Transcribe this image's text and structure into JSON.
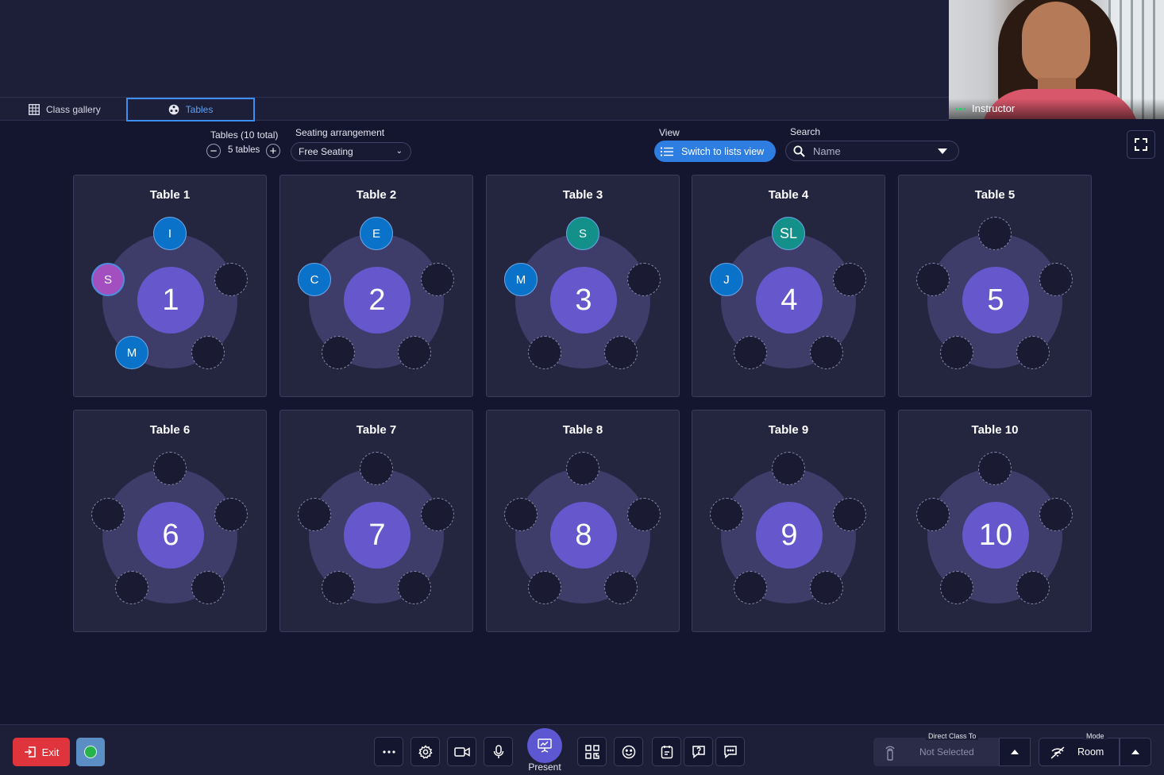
{
  "tabs": {
    "gallery_label": "Class gallery",
    "tables_label": "Tables"
  },
  "instructor": {
    "label": "Instructor"
  },
  "controls": {
    "tables_total_label": "Tables (10 total)",
    "tables_count": "5 tables",
    "seating_label": "Seating arrangement",
    "seating_value": "Free Seating",
    "view_label": "View",
    "switch_view_label": "Switch to lists view",
    "search_label": "Search",
    "search_value": "Name"
  },
  "tables": [
    {
      "name": "Table 1",
      "number": "1",
      "seats": [
        {
          "initial": "I",
          "color": "#0a72c9"
        },
        {
          "initial": "",
          "color": ""
        },
        {
          "initial": "",
          "color": ""
        },
        {
          "initial": "M",
          "color": "#0a72c9"
        },
        {
          "initial": "S",
          "color": "#a34fbf"
        }
      ]
    },
    {
      "name": "Table 2",
      "number": "2",
      "seats": [
        {
          "initial": "E",
          "color": "#0a72c9"
        },
        {
          "initial": "",
          "color": ""
        },
        {
          "initial": "",
          "color": ""
        },
        {
          "initial": "",
          "color": ""
        },
        {
          "initial": "C",
          "color": "#0a72c9"
        }
      ]
    },
    {
      "name": "Table 3",
      "number": "3",
      "seats": [
        {
          "initial": "S",
          "color": "#13908a"
        },
        {
          "initial": "",
          "color": ""
        },
        {
          "initial": "",
          "color": ""
        },
        {
          "initial": "",
          "color": ""
        },
        {
          "initial": "M",
          "color": "#0a72c9"
        }
      ]
    },
    {
      "name": "Table 4",
      "number": "4",
      "seats": [
        {
          "initial": "SL",
          "color": "#13908a"
        },
        {
          "initial": "",
          "color": ""
        },
        {
          "initial": "",
          "color": ""
        },
        {
          "initial": "",
          "color": ""
        },
        {
          "initial": "J",
          "color": "#0a72c9"
        }
      ]
    },
    {
      "name": "Table 5",
      "number": "5",
      "seats": [
        {
          "initial": "",
          "color": ""
        },
        {
          "initial": "",
          "color": ""
        },
        {
          "initial": "",
          "color": ""
        },
        {
          "initial": "",
          "color": ""
        },
        {
          "initial": "",
          "color": ""
        }
      ]
    },
    {
      "name": "Table 6",
      "number": "6",
      "seats": [
        {
          "initial": "",
          "color": ""
        },
        {
          "initial": "",
          "color": ""
        },
        {
          "initial": "",
          "color": ""
        },
        {
          "initial": "",
          "color": ""
        },
        {
          "initial": "",
          "color": ""
        }
      ]
    },
    {
      "name": "Table 7",
      "number": "7",
      "seats": [
        {
          "initial": "",
          "color": ""
        },
        {
          "initial": "",
          "color": ""
        },
        {
          "initial": "",
          "color": ""
        },
        {
          "initial": "",
          "color": ""
        },
        {
          "initial": "",
          "color": ""
        }
      ]
    },
    {
      "name": "Table 8",
      "number": "8",
      "seats": [
        {
          "initial": "",
          "color": ""
        },
        {
          "initial": "",
          "color": ""
        },
        {
          "initial": "",
          "color": ""
        },
        {
          "initial": "",
          "color": ""
        },
        {
          "initial": "",
          "color": ""
        }
      ]
    },
    {
      "name": "Table 9",
      "number": "9",
      "seats": [
        {
          "initial": "",
          "color": ""
        },
        {
          "initial": "",
          "color": ""
        },
        {
          "initial": "",
          "color": ""
        },
        {
          "initial": "",
          "color": ""
        },
        {
          "initial": "",
          "color": ""
        }
      ]
    },
    {
      "name": "Table 10",
      "number": "10",
      "seats": [
        {
          "initial": "",
          "color": ""
        },
        {
          "initial": "",
          "color": ""
        },
        {
          "initial": "",
          "color": ""
        },
        {
          "initial": "",
          "color": ""
        },
        {
          "initial": "",
          "color": ""
        }
      ]
    }
  ],
  "bottom": {
    "exit_label": "Exit",
    "present_label": "Present",
    "direct_label": "Direct Class To",
    "direct_value": "Not Selected",
    "mode_label": "Mode",
    "mode_value": "Room",
    "tool_icons": [
      "more-icon",
      "settings-icon",
      "camera-icon",
      "microphone-icon",
      "qr-code-icon",
      "emoji-icon",
      "notes-icon",
      "question-icon",
      "chat-icon"
    ]
  },
  "colors": {
    "accent": "#2e7de0",
    "table_center": "#6657cc",
    "exit": "#e0343c"
  }
}
